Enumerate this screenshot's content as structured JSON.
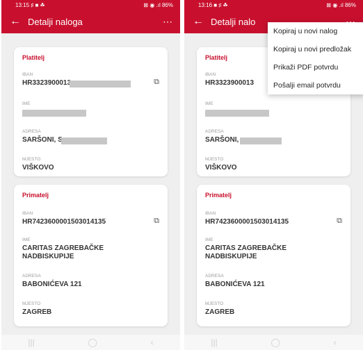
{
  "colors": {
    "brand": "#c8102e"
  },
  "screen1": {
    "status": {
      "time": "13:15",
      "left_icons": "♯ ■ ☘",
      "right_text": "⊠ ◉ .ıl 86%"
    },
    "appbar": {
      "back_icon": "←",
      "title": "Detalji naloga",
      "more_icon": "⋯"
    }
  },
  "screen2": {
    "status": {
      "time": "13:16",
      "left_icons": "■ ♯ ☘",
      "right_text": "⊠ ◉ .ıl 86%"
    },
    "appbar": {
      "back_icon": "←",
      "title": "Detalji nalo",
      "more_icon": "⋯"
    },
    "menu": [
      "Kopiraj u novi nalog",
      "Kopiraj u novi predložak",
      "Prikaži PDF potvrdu",
      "Pošalji email potvrdu"
    ]
  },
  "payer": {
    "title": "Platitelj",
    "iban_label": "IBAN",
    "iban_value_1": "HR3323900013",
    "iban_value_2": "HR3323900013",
    "ime_label": "IME",
    "adresa_label": "ADRESA",
    "adresa_value_1": "SARŠONI, S",
    "adresa_value_2": "SARŠONI,",
    "mjesto_label": "MJESTO",
    "mjesto_value": "VIŠKOVO"
  },
  "payee": {
    "title": "Primatelj",
    "iban_label": "IBAN",
    "iban_value": "HR7423600001503014135",
    "ime_label": "IME",
    "ime_value_line1": "CARITAS ZAGREBAČKE",
    "ime_value_line2": "NADBISKUPIJE",
    "adresa_label": "ADRESA",
    "adresa_value": "BABONIĆEVA 121",
    "mjesto_label": "MJESTO",
    "mjesto_value": "ZAGREB"
  },
  "icons": {
    "copy": "⧉",
    "nav_recent": "|||",
    "nav_home": "◯",
    "nav_back": "‹"
  }
}
